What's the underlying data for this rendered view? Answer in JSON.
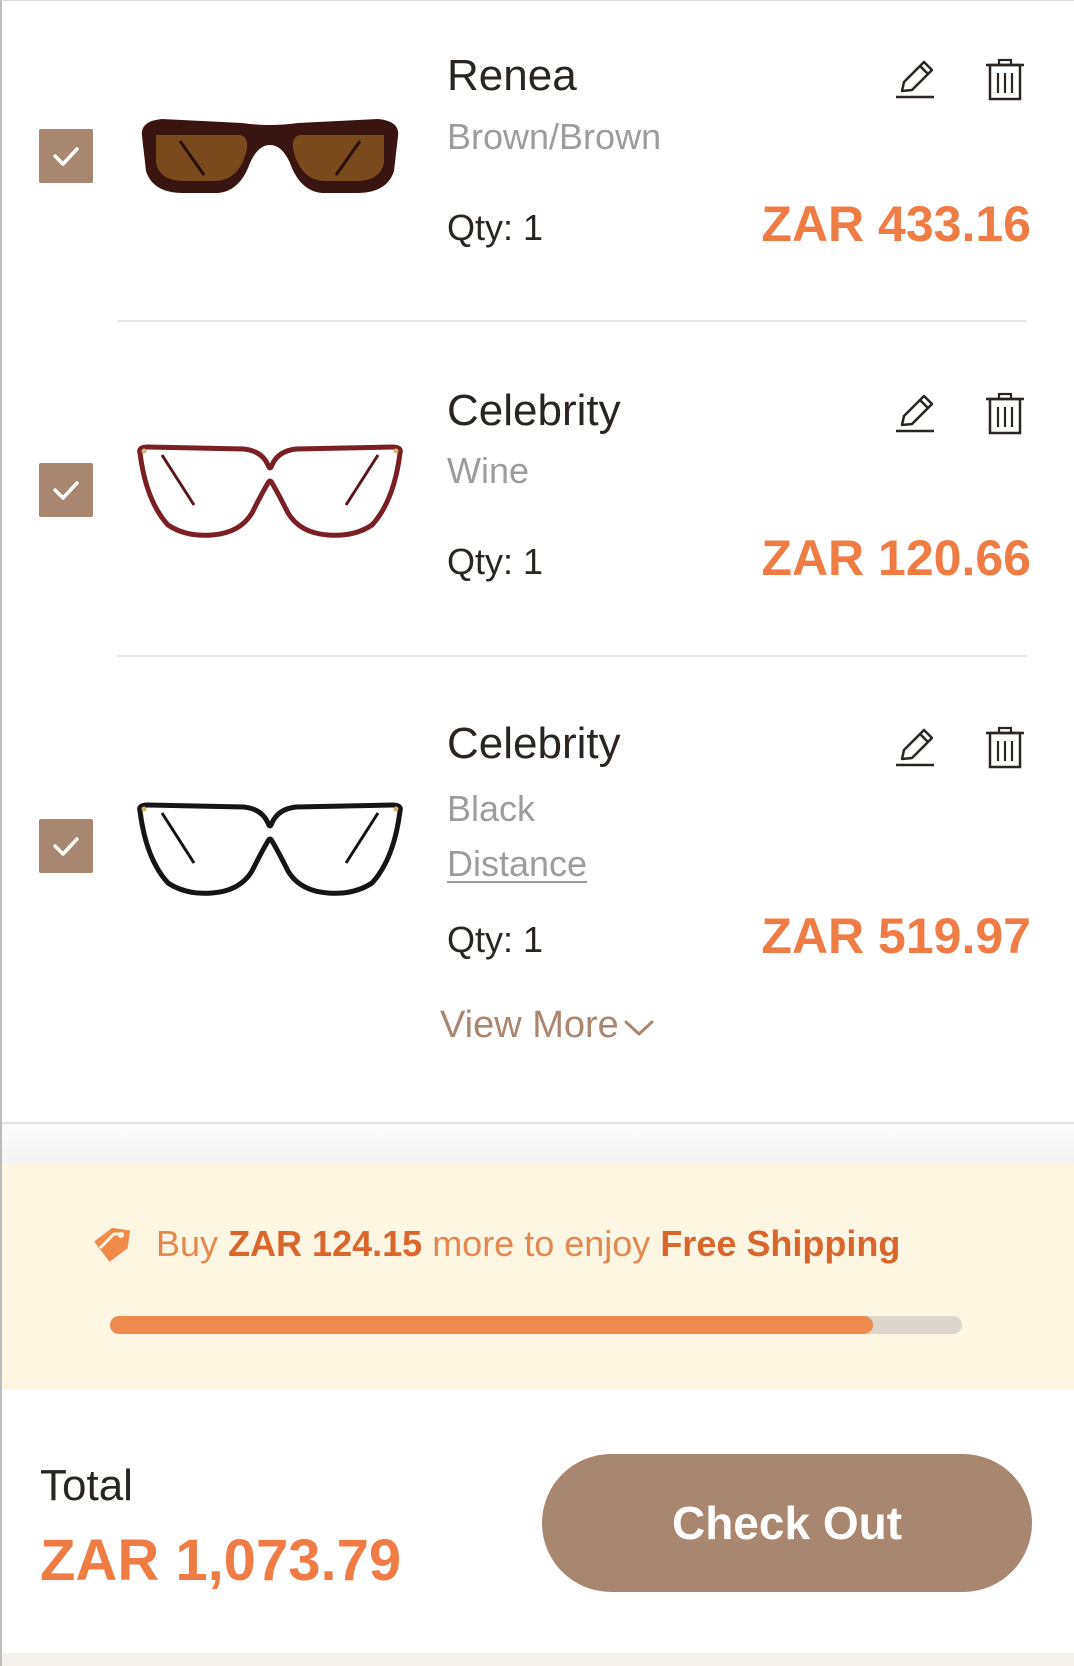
{
  "cart": {
    "items": [
      {
        "name": "Renea",
        "color": "Brown/Brown",
        "lens": "",
        "qty": "Qty: 1",
        "price": "ZAR 433.16",
        "checked": true,
        "thumbnail": "brown-cat-eye-sunglasses",
        "frame_color": "#3a1410",
        "lens_color": "#7a4a1c"
      },
      {
        "name": "Celebrity",
        "color": "Wine",
        "lens": "",
        "qty": "Qty: 1",
        "price": "ZAR 120.66",
        "checked": true,
        "thumbnail": "wine-cat-eye-glasses",
        "frame_color": "#7a1f25"
      },
      {
        "name": "Celebrity",
        "color": "Black",
        "lens": "Distance",
        "qty": "Qty: 1",
        "price": "ZAR 519.97",
        "checked": true,
        "thumbnail": "black-cat-eye-glasses",
        "frame_color": "#151515"
      }
    ],
    "view_more": "View More"
  },
  "shipping_banner": {
    "prefix": "Buy",
    "amount": "ZAR 124.15",
    "middle": "more to enjoy",
    "highlight": "Free Shipping",
    "icon": "tag-icon",
    "progress_percent": 89.6
  },
  "footer": {
    "total_label": "Total",
    "total_value": "ZAR 1,073.79",
    "checkout_label": "Check Out"
  },
  "colors": {
    "accent": "#a88670",
    "price": "#f07c45",
    "muted_text": "#9c9c9c",
    "banner_bg": "#fcf6e2"
  }
}
